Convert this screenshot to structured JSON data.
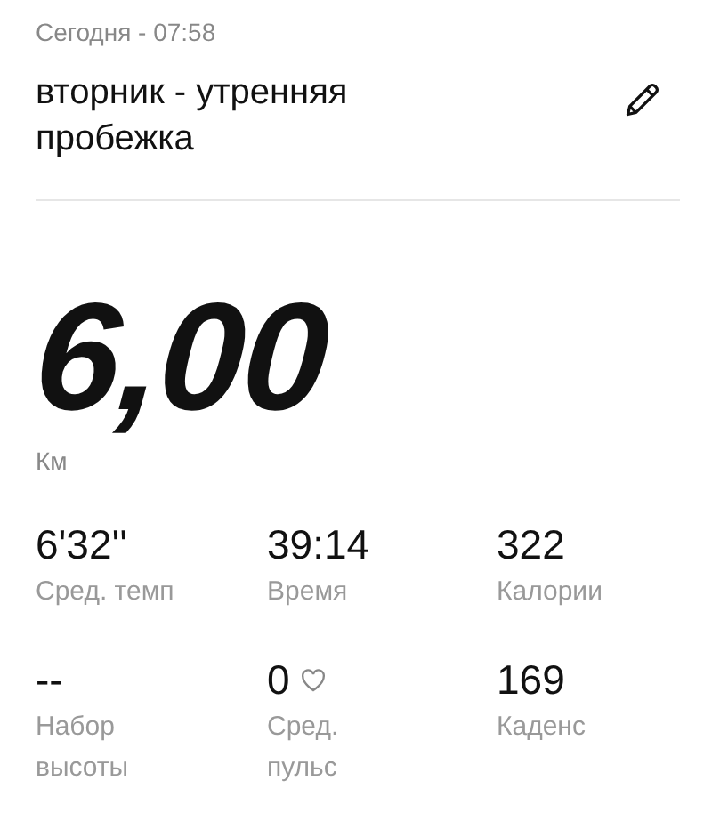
{
  "header": {
    "date": "Сегодня - 07:58",
    "title": "вторник - утренняя пробежка"
  },
  "distance": {
    "value": "6,00",
    "unit": "Км"
  },
  "stats": [
    {
      "kind": "plain",
      "value": "6'32''",
      "label": "Сред. темп"
    },
    {
      "kind": "plain",
      "value": "39:14",
      "label": "Время"
    },
    {
      "kind": "plain",
      "value": "322",
      "label": "Калории"
    },
    {
      "kind": "plain",
      "value": "--",
      "label": "Набор\nвысоты"
    },
    {
      "kind": "heart",
      "value": "0",
      "label": "Сред.\nпульс"
    },
    {
      "kind": "plain",
      "value": "169",
      "label": "Каденс"
    }
  ]
}
